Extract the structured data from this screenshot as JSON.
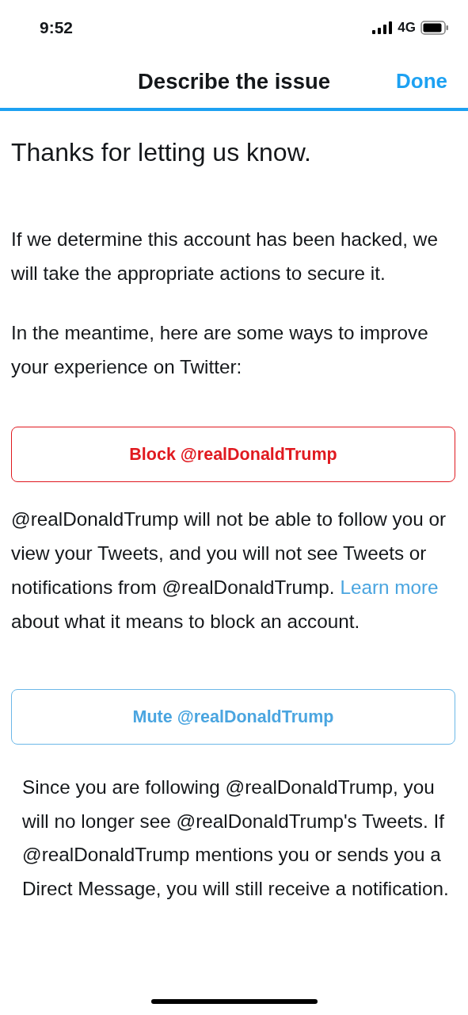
{
  "status_bar": {
    "time": "9:52",
    "network": "4G"
  },
  "header": {
    "title": "Describe the issue",
    "done": "Done"
  },
  "heading": "Thanks for letting us know.",
  "paragraphs": [
    "If we determine this account has been hacked, we will take the appropriate actions to secure it.",
    "In the meantime, here are some ways to improve your experience on Twitter:"
  ],
  "actions": [
    {
      "kind": "block",
      "label": "Block @realDonaldTrump",
      "description": [
        {
          "kind": "text",
          "text": "@realDonaldTrump will not be able to follow you or view your Tweets, and you will not see Tweets or notifications from @realDonaldTrump. "
        },
        {
          "kind": "link",
          "text": "Learn more"
        },
        {
          "kind": "text",
          "text": " about what it means to block an account."
        }
      ]
    },
    {
      "kind": "mute",
      "label": "Mute @realDonaldTrump",
      "description": [
        {
          "text": "Since you are following @realDonaldTrump, you will no longer see @realDonaldTrump's Tweets. If @realDonaldTrump mentions you or sends you a Direct Message, you will still receive a notification.",
          "kind": "text"
        }
      ]
    }
  ]
}
